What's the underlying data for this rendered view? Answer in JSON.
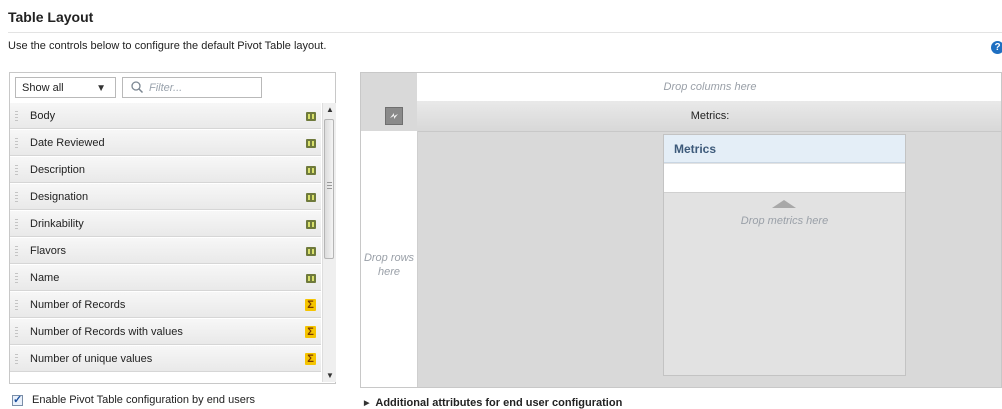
{
  "page": {
    "title": "Table Layout",
    "description": "Use the controls below to configure the default Pivot Table layout.",
    "help_icon": "?"
  },
  "fields_panel": {
    "show_select": {
      "value": "Show all"
    },
    "filter": {
      "placeholder": "Filter..."
    },
    "items": [
      {
        "label": "Body",
        "icon": "attribute-icon"
      },
      {
        "label": "Date Reviewed",
        "icon": "attribute-icon"
      },
      {
        "label": "Description",
        "icon": "attribute-icon"
      },
      {
        "label": "Designation",
        "icon": "attribute-icon"
      },
      {
        "label": "Drinkability",
        "icon": "attribute-icon"
      },
      {
        "label": "Flavors",
        "icon": "attribute-icon"
      },
      {
        "label": "Name",
        "icon": "attribute-icon"
      },
      {
        "label": "Number of Records",
        "icon": "sigma-icon",
        "glyph": "Σ"
      },
      {
        "label": "Number of Records with values",
        "icon": "sigma-icon",
        "glyph": "Σ"
      },
      {
        "label": "Number of unique values",
        "icon": "sigma-icon",
        "glyph": "Σ"
      }
    ],
    "enable_checkbox": {
      "label": "Enable Pivot Table configuration by end users",
      "checked": true
    }
  },
  "pivot_area": {
    "drop_columns": "Drop columns here",
    "metrics_bar": "Metrics:",
    "drop_rows": "Drop rows here",
    "metrics_box": {
      "title": "Metrics",
      "drop_text": "Drop metrics here"
    }
  },
  "additional": {
    "label": "Additional attributes for end user configuration"
  },
  "colors": {
    "accent": "#1f6fc1",
    "metrics_header": "#e4eef7",
    "sigma": "#f5c400"
  }
}
